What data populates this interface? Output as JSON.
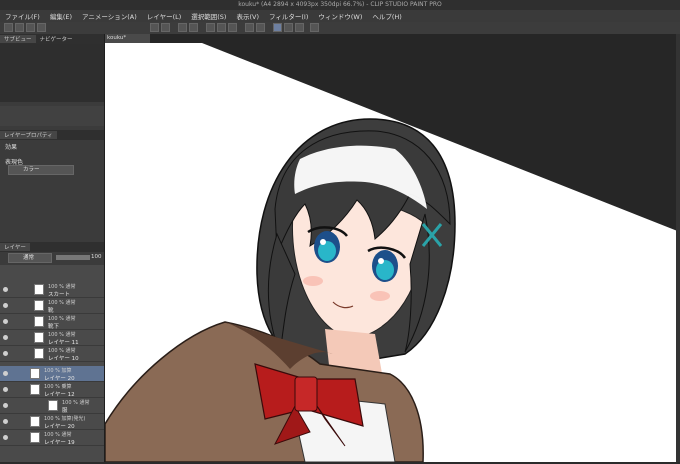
{
  "window": {
    "title": "kouku* (A4 2894 x 4093px 350dpi 66.7%) - CLIP STUDIO PAINT PRO"
  },
  "menu": [
    "ファイル(F)",
    "編集(E)",
    "アニメーション(A)",
    "レイヤー(L)",
    "選択範囲(S)",
    "表示(V)",
    "フィルター(I)",
    "ウィンドウ(W)",
    "ヘルプ(H)"
  ],
  "document_tab": {
    "label": "kouku*"
  },
  "panels": {
    "top_tabs": [
      "サブビュー",
      "ナビゲーター"
    ],
    "property_tabs": [
      "レイヤープロパティ"
    ],
    "effect_label": "効果",
    "expression_color_label": "表現色",
    "expression_color_value": "カラー",
    "layer_tabs": [
      "レイヤー"
    ],
    "blend_mode": "通常",
    "opacity": "100"
  },
  "layers": [
    {
      "line1": "100 % 通常",
      "line2": "スカート",
      "selected": false
    },
    {
      "line1": "100 % 通常",
      "line2": "靴",
      "selected": false
    },
    {
      "line1": "100 % 通常",
      "line2": "靴下",
      "selected": false
    },
    {
      "line1": "100 % 通常",
      "line2": "レイヤー 11",
      "selected": false
    },
    {
      "line1": "100 % 通常",
      "line2": "レイヤー 10",
      "selected": false
    },
    {
      "line1": "100 % 加算",
      "line2": "レイヤー 20",
      "selected": true
    },
    {
      "line1": "100 % 乗算",
      "line2": "レイヤー 12",
      "selected": false
    },
    {
      "line1": "100 % 通常",
      "line2": "服",
      "selected": false
    },
    {
      "line1": "100 % 加算(発光)",
      "line2": "レイヤー 20",
      "selected": false
    },
    {
      "line1": "100 % 通常",
      "line2": "レイヤー 19",
      "selected": false
    }
  ]
}
